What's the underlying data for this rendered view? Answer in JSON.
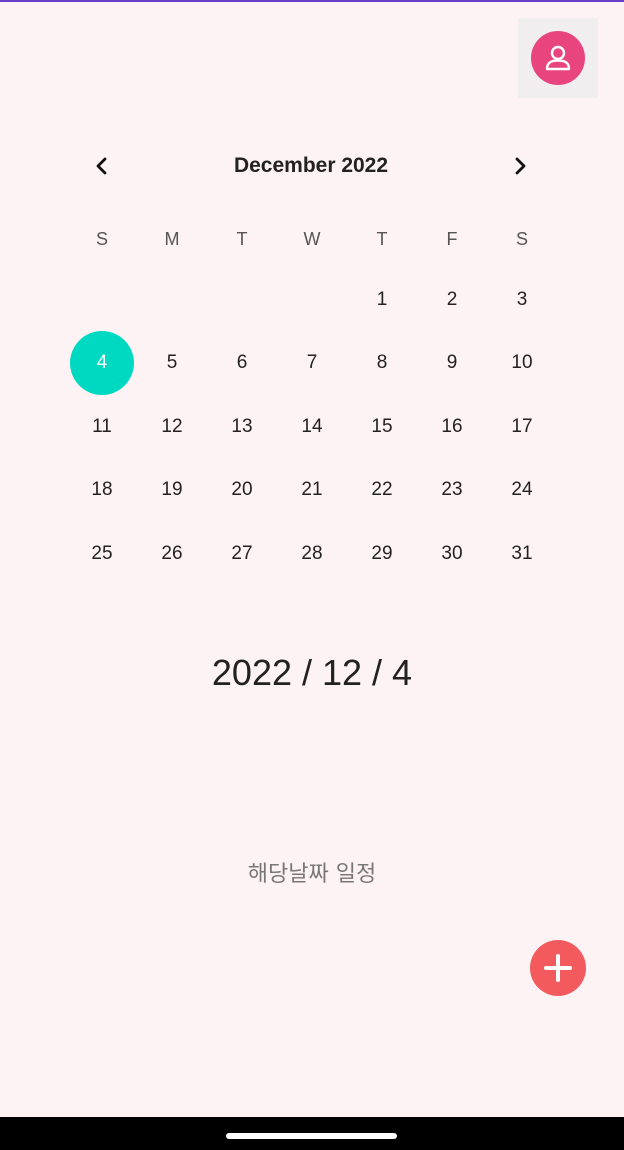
{
  "colors": {
    "background": "#fdf3f4",
    "profile_accent": "#e8457f",
    "selected_day": "#00d9c2",
    "fab_accent": "#f25a5e",
    "top_line": "#6a3cc8"
  },
  "profile": {
    "icon": "person-icon"
  },
  "calendar": {
    "month_label": "December 2022",
    "prev_icon": "chevron-left-icon",
    "next_icon": "chevron-right-icon",
    "weekdays": [
      "S",
      "M",
      "T",
      "W",
      "T",
      "F",
      "S"
    ],
    "weeks": [
      [
        "",
        "",
        "",
        "",
        "1",
        "2",
        "3"
      ],
      [
        "4",
        "5",
        "6",
        "7",
        "8",
        "9",
        "10"
      ],
      [
        "11",
        "12",
        "13",
        "14",
        "15",
        "16",
        "17"
      ],
      [
        "18",
        "19",
        "20",
        "21",
        "22",
        "23",
        "24"
      ],
      [
        "25",
        "26",
        "27",
        "28",
        "29",
        "30",
        "31"
      ]
    ],
    "selected_day": "4"
  },
  "selected_date": "2022 / 12 / 4",
  "schedule_label": "해당날짜 일정",
  "fab": {
    "icon": "plus-icon"
  }
}
